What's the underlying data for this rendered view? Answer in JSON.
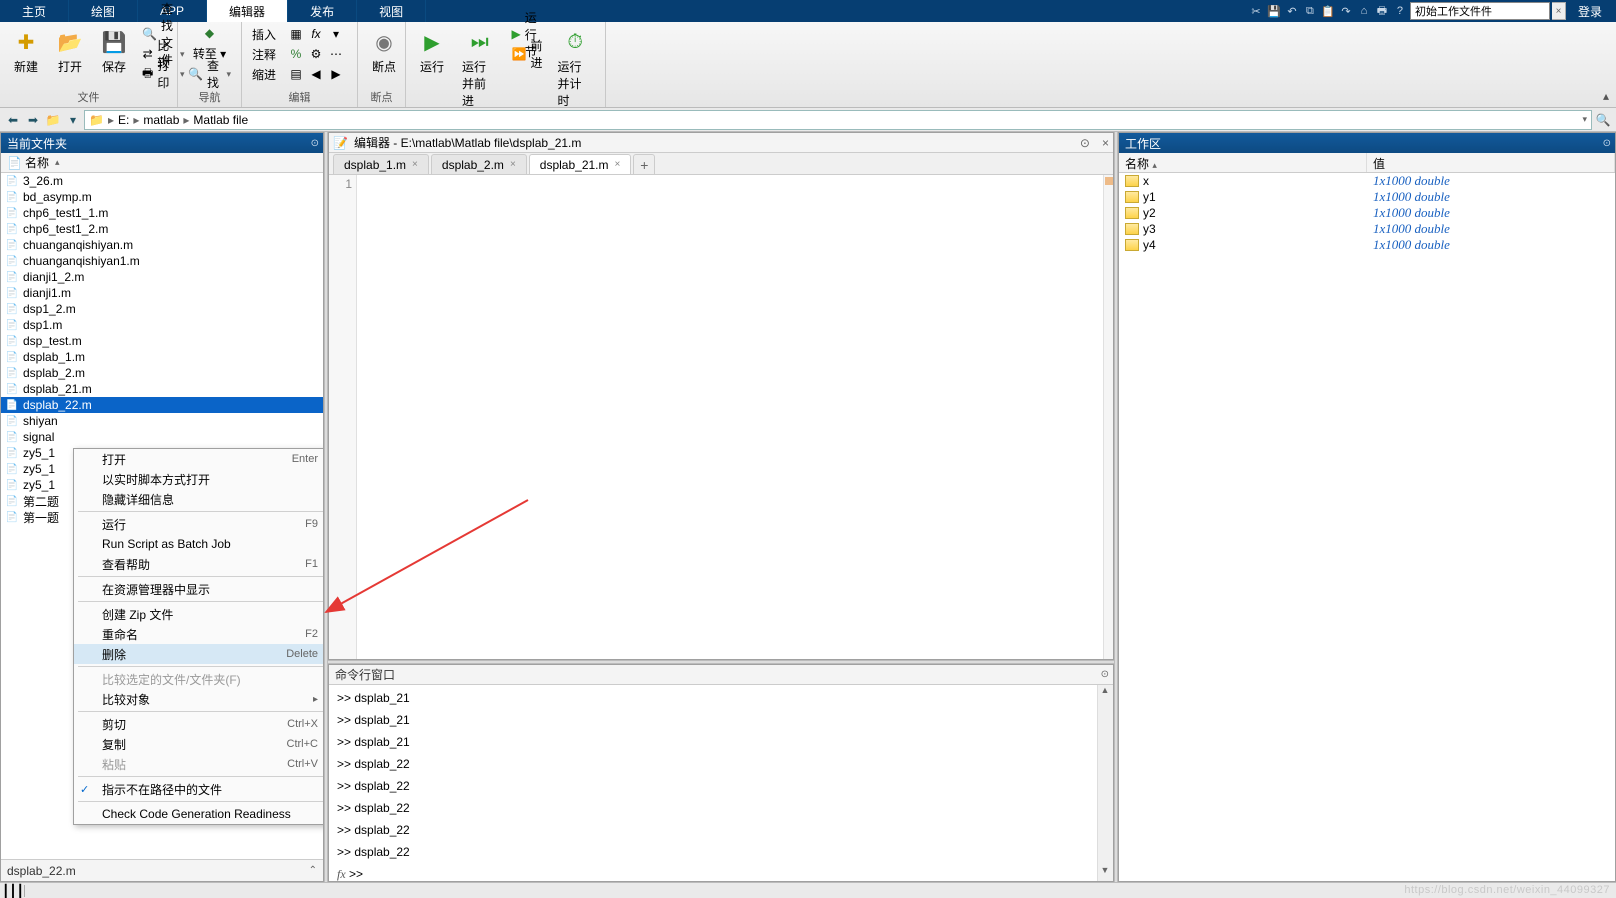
{
  "top_tabs": [
    "主页",
    "绘图",
    "APP",
    "编辑器",
    "发布",
    "视图"
  ],
  "active_top_tab": "编辑器",
  "search_placeholder": "初始工作文件件",
  "login_label": "登录",
  "ribbon": {
    "groups": {
      "file": {
        "label": "文件",
        "new": "新建",
        "open": "打开",
        "save": "保存",
        "find_files": "查找文件",
        "compare": "比较",
        "print": "打印"
      },
      "nav": {
        "label": "导航",
        "goto": "转至",
        "find": "查找"
      },
      "edit": {
        "label": "编辑",
        "insert": "插入",
        "comment": "注释",
        "indent": "缩进"
      },
      "bp": {
        "label": "断点",
        "breakpoint": "断点"
      },
      "run": {
        "label": "运行",
        "run": "运行",
        "run_advance": "运行并前进",
        "run_section": "运行节",
        "advance": "前进",
        "run_time": "运行并计时"
      }
    }
  },
  "path": {
    "drive": "E:",
    "seg1": "matlab",
    "seg2": "Matlab file"
  },
  "left_panel_title": "当前文件夹",
  "file_header": "名称",
  "files": [
    "3_26.m",
    "bd_asymp.m",
    "chp6_test1_1.m",
    "chp6_test1_2.m",
    "chuanganqishiyan.m",
    "chuanganqishiyan1.m",
    "dianji1_2.m",
    "dianji1.m",
    "dsp1_2.m",
    "dsp1.m",
    "dsp_test.m",
    "dsplab_1.m",
    "dsplab_2.m",
    "dsplab_21.m",
    "dsplab_22.m",
    "shiyan",
    "signal",
    "zy5_1",
    "zy5_1",
    "zy5_1",
    "第二题",
    "第一题"
  ],
  "selected_file": "dsplab_22.m",
  "preview_filename": "dsplab_22.m",
  "context_menu": [
    {
      "label": "打开",
      "shortcut": "Enter"
    },
    {
      "label": "以实时脚本方式打开"
    },
    {
      "label": "隐藏详细信息"
    },
    {
      "sep": true
    },
    {
      "label": "运行",
      "shortcut": "F9"
    },
    {
      "label": "Run Script as Batch Job"
    },
    {
      "label": "查看帮助",
      "shortcut": "F1"
    },
    {
      "sep": true
    },
    {
      "label": "在资源管理器中显示"
    },
    {
      "sep": true
    },
    {
      "label": "创建 Zip 文件"
    },
    {
      "label": "重命名",
      "shortcut": "F2"
    },
    {
      "label": "删除",
      "shortcut": "Delete",
      "hover": true
    },
    {
      "sep": true
    },
    {
      "label": "比较选定的文件/文件夹(F)",
      "disabled": true
    },
    {
      "label": "比较对象",
      "submenu": true
    },
    {
      "sep": true
    },
    {
      "label": "剪切",
      "shortcut": "Ctrl+X"
    },
    {
      "label": "复制",
      "shortcut": "Ctrl+C"
    },
    {
      "label": "粘贴",
      "shortcut": "Ctrl+V",
      "disabled": true
    },
    {
      "sep": true
    },
    {
      "label": "指示不在路径中的文件",
      "checked": true
    },
    {
      "sep": true
    },
    {
      "label": "Check Code Generation Readiness"
    }
  ],
  "editor": {
    "title_prefix": "编辑器 - ",
    "title_path": "E:\\matlab\\Matlab file\\dsplab_21.m",
    "tabs": [
      "dsplab_1.m",
      "dsplab_2.m",
      "dsplab_21.m"
    ],
    "active_tab": "dsplab_21.m",
    "line_no": "1"
  },
  "cmd": {
    "title": "命令行窗口",
    "lines": [
      "dsplab_21",
      "dsplab_21",
      "dsplab_21",
      "dsplab_22",
      "dsplab_22",
      "dsplab_22",
      "dsplab_22",
      "dsplab_22"
    ],
    "prompt_fx": "fx",
    "prompt": ">> "
  },
  "workspace": {
    "title": "工作区",
    "col_name": "名称",
    "col_value": "值",
    "vars": [
      {
        "name": "x",
        "value": "1x1000 double"
      },
      {
        "name": "y1",
        "value": "1x1000 double"
      },
      {
        "name": "y2",
        "value": "1x1000 double"
      },
      {
        "name": "y3",
        "value": "1x1000 double"
      },
      {
        "name": "y4",
        "value": "1x1000 double"
      }
    ]
  },
  "watermark": "https://blog.csdn.net/weixin_44099327"
}
